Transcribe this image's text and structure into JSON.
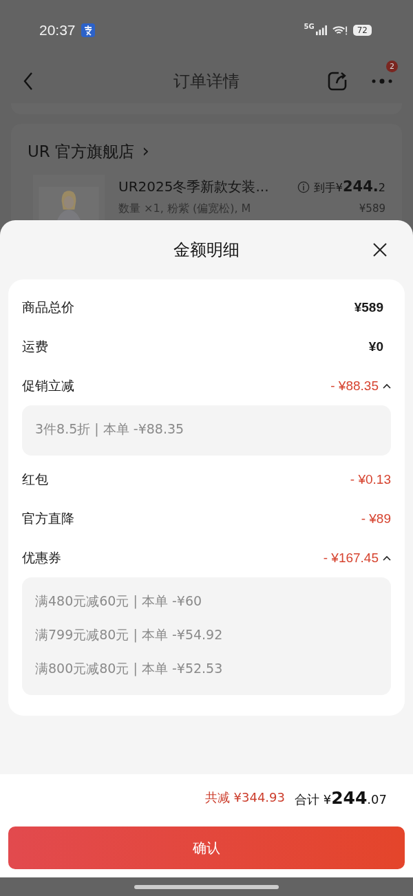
{
  "status_bar": {
    "time": "20:37",
    "network": "5G",
    "battery": "72"
  },
  "nav": {
    "title": "订单详情",
    "badge": "2"
  },
  "store": {
    "name": "UR 官方旗舰店",
    "chevron": "›"
  },
  "product": {
    "title": "UR2025冬季新款女装...",
    "price_label": "到手",
    "price_currency": "¥",
    "price_int": "244.",
    "price_dec": "2",
    "variant": "数量 ×1, 粉紫 (偏宽松), M",
    "original_price": "¥589"
  },
  "sheet": {
    "title": "金额明细",
    "rows": [
      {
        "label": "商品总价",
        "value": "¥589",
        "kind": "plain"
      },
      {
        "label": "运费",
        "value": "¥0",
        "kind": "plain"
      },
      {
        "label": "促销立减",
        "value": "- ¥88.35",
        "kind": "discount",
        "expanded": true,
        "details": [
          "3件8.5折 | 本单 -¥88.35"
        ]
      },
      {
        "label": "红包",
        "value": "- ¥0.13",
        "kind": "discount"
      },
      {
        "label": "官方直降",
        "value": "- ¥89",
        "kind": "discount"
      },
      {
        "label": "优惠券",
        "value": "- ¥167.45",
        "kind": "discount",
        "expanded": true,
        "details": [
          "满480元减60元 | 本单 -¥60",
          "满799元减80元 | 本单 -¥54.92",
          "满800元减80元 | 本单 -¥52.53"
        ]
      }
    ]
  },
  "footer": {
    "saved_label": "共减",
    "saved_value": "¥344.93",
    "total_label": "合计",
    "total_currency": "¥",
    "total_int": "244",
    "total_dec": ".07",
    "button": "确认"
  }
}
